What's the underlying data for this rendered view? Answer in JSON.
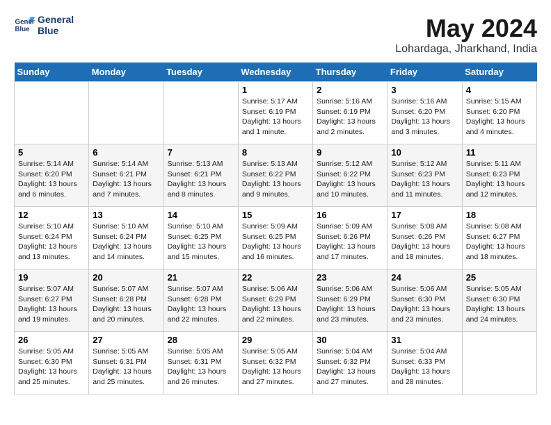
{
  "header": {
    "logo_line1": "General",
    "logo_line2": "Blue",
    "title": "May 2024",
    "subtitle": "Lohardaga, Jharkhand, India"
  },
  "weekdays": [
    "Sunday",
    "Monday",
    "Tuesday",
    "Wednesday",
    "Thursday",
    "Friday",
    "Saturday"
  ],
  "weeks": [
    [
      {
        "day": "",
        "sunrise": "",
        "sunset": "",
        "daylight": ""
      },
      {
        "day": "",
        "sunrise": "",
        "sunset": "",
        "daylight": ""
      },
      {
        "day": "",
        "sunrise": "",
        "sunset": "",
        "daylight": ""
      },
      {
        "day": "1",
        "sunrise": "Sunrise: 5:17 AM",
        "sunset": "Sunset: 6:19 PM",
        "daylight": "Daylight: 13 hours and 1 minute."
      },
      {
        "day": "2",
        "sunrise": "Sunrise: 5:16 AM",
        "sunset": "Sunset: 6:19 PM",
        "daylight": "Daylight: 13 hours and 2 minutes."
      },
      {
        "day": "3",
        "sunrise": "Sunrise: 5:16 AM",
        "sunset": "Sunset: 6:20 PM",
        "daylight": "Daylight: 13 hours and 3 minutes."
      },
      {
        "day": "4",
        "sunrise": "Sunrise: 5:15 AM",
        "sunset": "Sunset: 6:20 PM",
        "daylight": "Daylight: 13 hours and 4 minutes."
      }
    ],
    [
      {
        "day": "5",
        "sunrise": "Sunrise: 5:14 AM",
        "sunset": "Sunset: 6:20 PM",
        "daylight": "Daylight: 13 hours and 6 minutes."
      },
      {
        "day": "6",
        "sunrise": "Sunrise: 5:14 AM",
        "sunset": "Sunset: 6:21 PM",
        "daylight": "Daylight: 13 hours and 7 minutes."
      },
      {
        "day": "7",
        "sunrise": "Sunrise: 5:13 AM",
        "sunset": "Sunset: 6:21 PM",
        "daylight": "Daylight: 13 hours and 8 minutes."
      },
      {
        "day": "8",
        "sunrise": "Sunrise: 5:13 AM",
        "sunset": "Sunset: 6:22 PM",
        "daylight": "Daylight: 13 hours and 9 minutes."
      },
      {
        "day": "9",
        "sunrise": "Sunrise: 5:12 AM",
        "sunset": "Sunset: 6:22 PM",
        "daylight": "Daylight: 13 hours and 10 minutes."
      },
      {
        "day": "10",
        "sunrise": "Sunrise: 5:12 AM",
        "sunset": "Sunset: 6:23 PM",
        "daylight": "Daylight: 13 hours and 11 minutes."
      },
      {
        "day": "11",
        "sunrise": "Sunrise: 5:11 AM",
        "sunset": "Sunset: 6:23 PM",
        "daylight": "Daylight: 13 hours and 12 minutes."
      }
    ],
    [
      {
        "day": "12",
        "sunrise": "Sunrise: 5:10 AM",
        "sunset": "Sunset: 6:24 PM",
        "daylight": "Daylight: 13 hours and 13 minutes."
      },
      {
        "day": "13",
        "sunrise": "Sunrise: 5:10 AM",
        "sunset": "Sunset: 6:24 PM",
        "daylight": "Daylight: 13 hours and 14 minutes."
      },
      {
        "day": "14",
        "sunrise": "Sunrise: 5:10 AM",
        "sunset": "Sunset: 6:25 PM",
        "daylight": "Daylight: 13 hours and 15 minutes."
      },
      {
        "day": "15",
        "sunrise": "Sunrise: 5:09 AM",
        "sunset": "Sunset: 6:25 PM",
        "daylight": "Daylight: 13 hours and 16 minutes."
      },
      {
        "day": "16",
        "sunrise": "Sunrise: 5:09 AM",
        "sunset": "Sunset: 6:26 PM",
        "daylight": "Daylight: 13 hours and 17 minutes."
      },
      {
        "day": "17",
        "sunrise": "Sunrise: 5:08 AM",
        "sunset": "Sunset: 6:26 PM",
        "daylight": "Daylight: 13 hours and 18 minutes."
      },
      {
        "day": "18",
        "sunrise": "Sunrise: 5:08 AM",
        "sunset": "Sunset: 6:27 PM",
        "daylight": "Daylight: 13 hours and 18 minutes."
      }
    ],
    [
      {
        "day": "19",
        "sunrise": "Sunrise: 5:07 AM",
        "sunset": "Sunset: 6:27 PM",
        "daylight": "Daylight: 13 hours and 19 minutes."
      },
      {
        "day": "20",
        "sunrise": "Sunrise: 5:07 AM",
        "sunset": "Sunset: 6:28 PM",
        "daylight": "Daylight: 13 hours and 20 minutes."
      },
      {
        "day": "21",
        "sunrise": "Sunrise: 5:07 AM",
        "sunset": "Sunset: 6:28 PM",
        "daylight": "Daylight: 13 hours and 22 minutes."
      },
      {
        "day": "22",
        "sunrise": "Sunrise: 5:06 AM",
        "sunset": "Sunset: 6:29 PM",
        "daylight": "Daylight: 13 hours and 22 minutes."
      },
      {
        "day": "23",
        "sunrise": "Sunrise: 5:06 AM",
        "sunset": "Sunset: 6:29 PM",
        "daylight": "Daylight: 13 hours and 23 minutes."
      },
      {
        "day": "24",
        "sunrise": "Sunrise: 5:06 AM",
        "sunset": "Sunset: 6:30 PM",
        "daylight": "Daylight: 13 hours and 23 minutes."
      },
      {
        "day": "25",
        "sunrise": "Sunrise: 5:05 AM",
        "sunset": "Sunset: 6:30 PM",
        "daylight": "Daylight: 13 hours and 24 minutes."
      }
    ],
    [
      {
        "day": "26",
        "sunrise": "Sunrise: 5:05 AM",
        "sunset": "Sunset: 6:30 PM",
        "daylight": "Daylight: 13 hours and 25 minutes."
      },
      {
        "day": "27",
        "sunrise": "Sunrise: 5:05 AM",
        "sunset": "Sunset: 6:31 PM",
        "daylight": "Daylight: 13 hours and 25 minutes."
      },
      {
        "day": "28",
        "sunrise": "Sunrise: 5:05 AM",
        "sunset": "Sunset: 6:31 PM",
        "daylight": "Daylight: 13 hours and 26 minutes."
      },
      {
        "day": "29",
        "sunrise": "Sunrise: 5:05 AM",
        "sunset": "Sunset: 6:32 PM",
        "daylight": "Daylight: 13 hours and 27 minutes."
      },
      {
        "day": "30",
        "sunrise": "Sunrise: 5:04 AM",
        "sunset": "Sunset: 6:32 PM",
        "daylight": "Daylight: 13 hours and 27 minutes."
      },
      {
        "day": "31",
        "sunrise": "Sunrise: 5:04 AM",
        "sunset": "Sunset: 6:33 PM",
        "daylight": "Daylight: 13 hours and 28 minutes."
      },
      {
        "day": "",
        "sunrise": "",
        "sunset": "",
        "daylight": ""
      }
    ]
  ]
}
